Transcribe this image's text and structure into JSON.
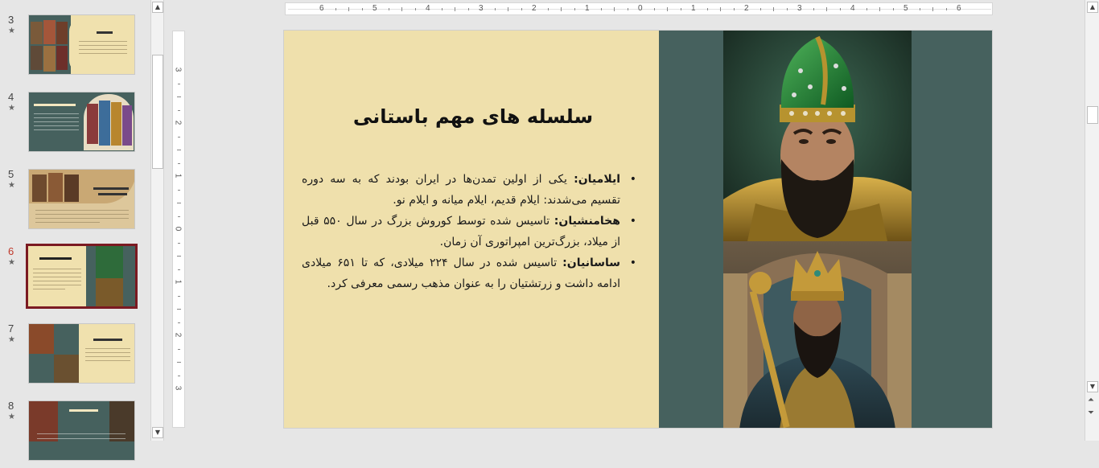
{
  "thumbnails": [
    {
      "number": "3",
      "star": "★",
      "title": "ایلام"
    },
    {
      "number": "4",
      "star": "★",
      "title": "تنوع قومی و مذهبی"
    },
    {
      "number": "5",
      "star": "★",
      "title": "دارای حکومت مرکزی و دیوان سالاری"
    },
    {
      "number": "6",
      "star": "★",
      "title": "سلسله های مهم باستانی"
    },
    {
      "number": "7",
      "star": "★",
      "title": "سلسله های مهم باستانی"
    },
    {
      "number": "8",
      "star": "★",
      "title": "سلسله های معاصر"
    }
  ],
  "ruler": {
    "h_labels": [
      "6",
      "5",
      "4",
      "3",
      "2",
      "1",
      "0",
      "1",
      "2",
      "3",
      "4",
      "5",
      "6"
    ],
    "v_labels": [
      "3",
      "2",
      "1",
      "0",
      "1",
      "2",
      "3"
    ]
  },
  "slide": {
    "title": "سلسله های مهم باستانی",
    "bullets": [
      {
        "bullet": "•",
        "term": "ایلامیان:",
        "text": " یکی از اولین تمدن‌ها در ایران بودند که به سه دوره تقسیم می‌شدند: ایلام قدیم، ایلام میانه و ایلام نو."
      },
      {
        "bullet": "•",
        "term": "هخامنشیان:",
        "text": " تاسیس شده توسط کوروش بزرگ در سال ۵۵۰ قبل از میلاد، بزرگ‌ترین امپراتوری آن زمان."
      },
      {
        "bullet": "•",
        "term": "ساسانیان:",
        "text": " تاسیس شده در سال ۲۲۴ میلادی، که تا ۶۵۱ میلادی ادامه داشت و زرتشتیان را به عنوان مذهب رسمی معرفی کرد."
      }
    ]
  },
  "scroll": {
    "up": "▲",
    "down": "▼",
    "prev": "⏶",
    "next": "⏷"
  },
  "colors": {
    "slide_bg": "#efe0ac",
    "panel": "#46615e",
    "selected_border": "#7b1a22",
    "active_number": "#c0392b"
  }
}
